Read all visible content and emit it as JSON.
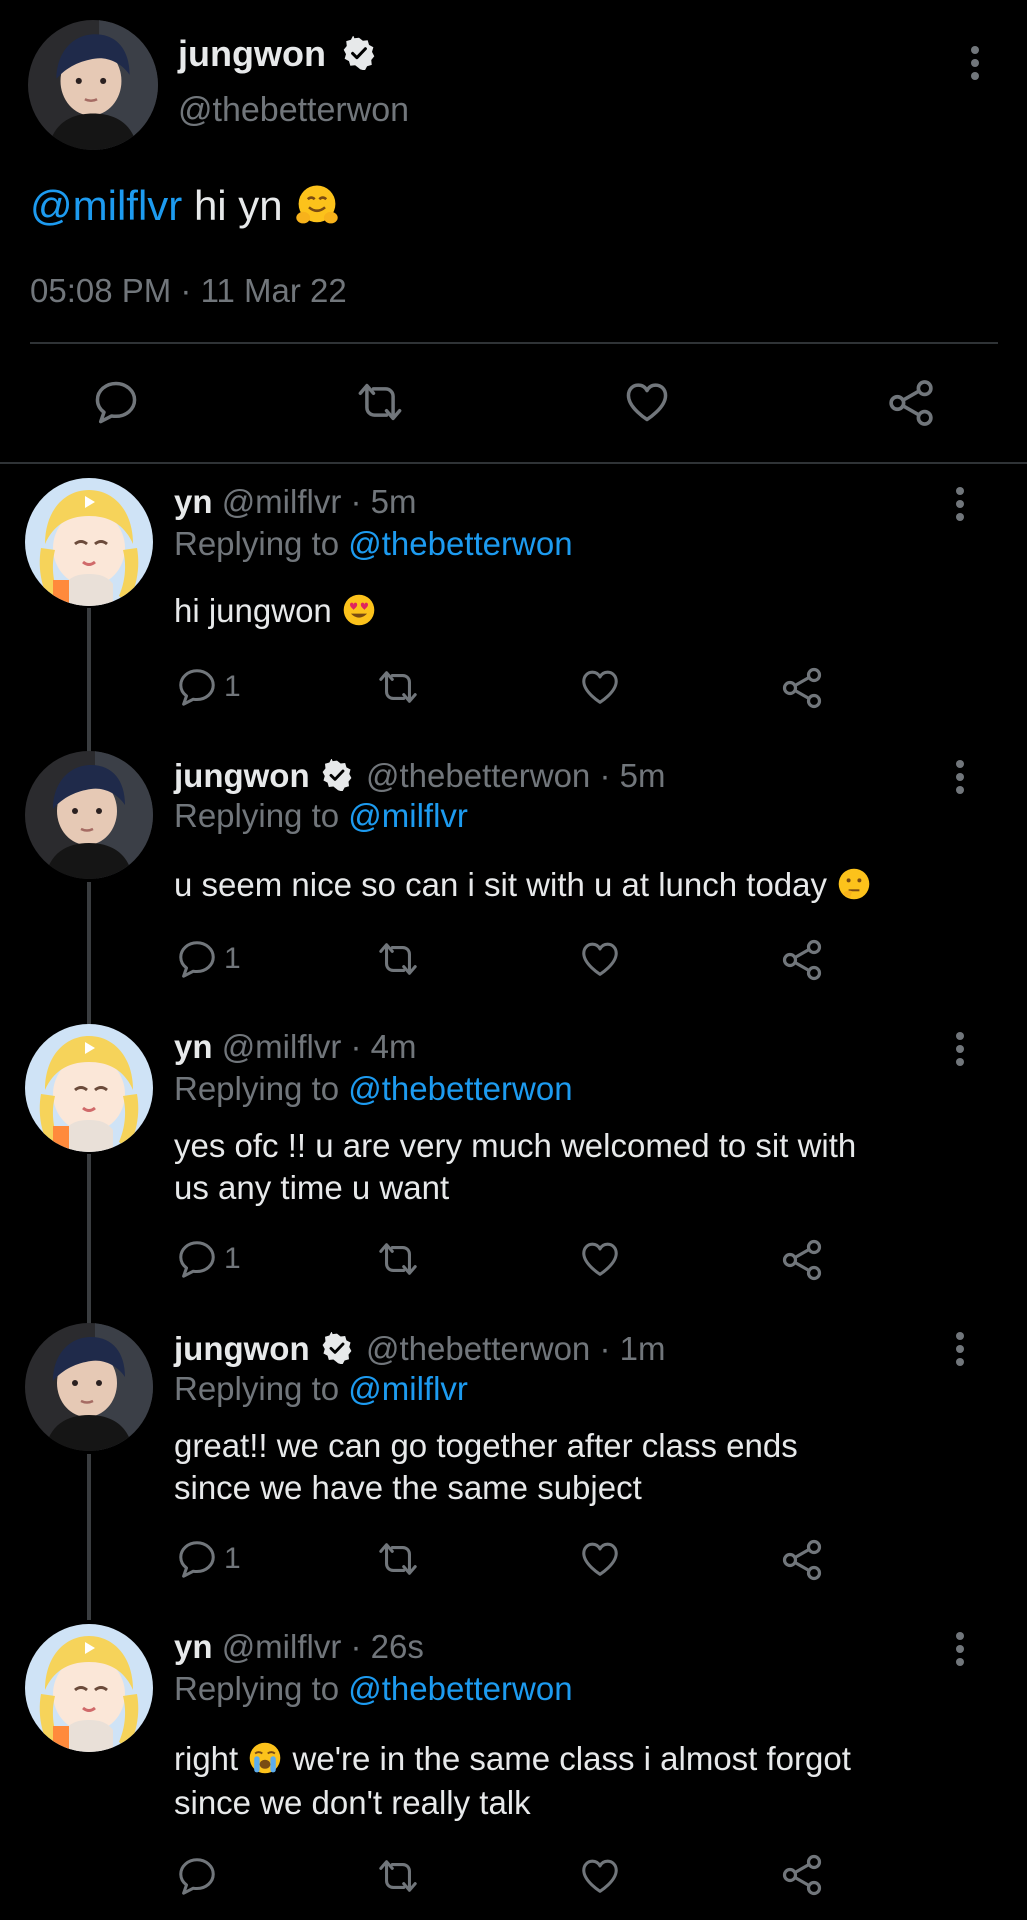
{
  "main_tweet": {
    "name": "jungwon",
    "handle": "@thebetterwon",
    "mention": "@milflvr",
    "text": " hi yn ",
    "timestamp": "05:08 PM · 11 Mar 22"
  },
  "replies": [
    {
      "name": "yn",
      "meta": "@milflvr · 5m",
      "replying_label": "Replying to ",
      "replying_handle": "@thebetterwon",
      "line1": "hi jungwon ",
      "line2": "",
      "reply_count": "1",
      "verified": false
    },
    {
      "name": "jungwon",
      "meta": "@thebetterwon · 5m",
      "replying_label": "Replying to ",
      "replying_handle": "@milflvr",
      "line1": "u seem nice so can i sit with u at lunch today ",
      "line2": "",
      "reply_count": "1",
      "verified": true
    },
    {
      "name": "yn",
      "meta": "@milflvr · 4m",
      "replying_label": "Replying to ",
      "replying_handle": "@thebetterwon",
      "line1": "yes ofc !! u are very much welcomed to sit with",
      "line2": "us any time u want",
      "reply_count": "1",
      "verified": false
    },
    {
      "name": "jungwon",
      "meta": "@thebetterwon · 1m",
      "replying_label": "Replying to ",
      "replying_handle": "@milflvr",
      "line1": "great!! we can go together after class ends",
      "line2": "since we have the same subject",
      "reply_count": "1",
      "verified": true
    },
    {
      "name": "yn",
      "meta": "@milflvr · 26s",
      "replying_label": "Replying to ",
      "replying_handle": "@thebetterwon",
      "line1_a": "right ",
      "line1_b": " we're in the same class i almost forgot",
      "line2": "since we don't really talk",
      "reply_count": "",
      "verified": false
    }
  ],
  "icons": {
    "reply": "reply-icon",
    "retweet": "retweet-icon",
    "like": "heart-icon",
    "share": "share-icon",
    "more": "more-vertical-icon",
    "verified": "verified-badge-icon"
  },
  "colors": {
    "background": "#000000",
    "link": "#1d9bf0",
    "muted": "#71767b",
    "text": "#e7e9ea"
  }
}
